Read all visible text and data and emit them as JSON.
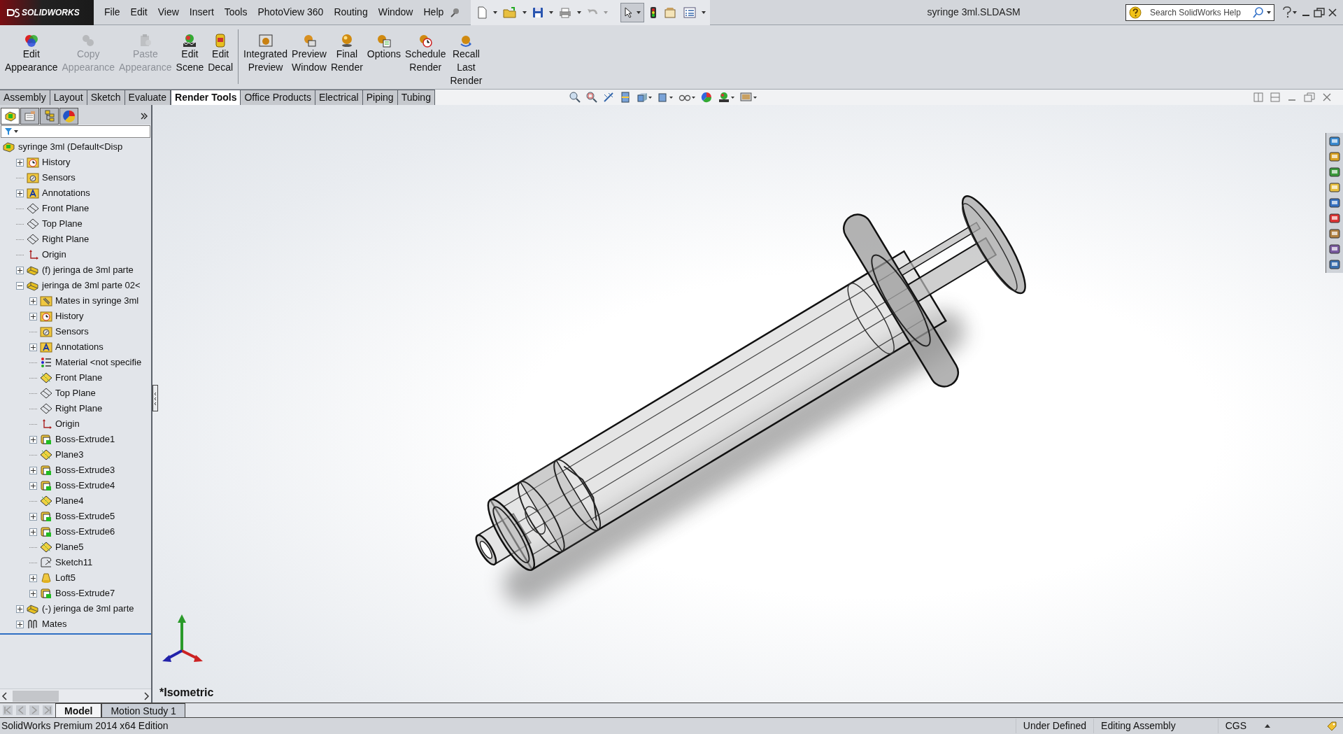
{
  "app": {
    "logo": "SOLIDWORKS",
    "menu": [
      "File",
      "Edit",
      "View",
      "Insert",
      "Tools",
      "PhotoView 360",
      "Routing",
      "Window",
      "Help"
    ],
    "title": "syringe 3ml.SLDASM",
    "search": {
      "placeholder": "Search SolidWorks Help"
    }
  },
  "ribbon": {
    "groups": [
      [
        {
          "label": "Edit\nAppearance",
          "disabled": false
        },
        {
          "label": "Copy\nAppearance",
          "disabled": true
        },
        {
          "label": "Paste\nAppearance",
          "disabled": true
        },
        {
          "label": "Edit\nScene",
          "disabled": false
        },
        {
          "label": "Edit\nDecal",
          "disabled": false
        }
      ],
      [
        {
          "label": "Integrated\nPreview",
          "disabled": false
        },
        {
          "label": "Preview\nWindow",
          "disabled": false
        },
        {
          "label": "Final\nRender",
          "disabled": false
        },
        {
          "label": "Options",
          "disabled": false
        },
        {
          "label": "Schedule\nRender",
          "disabled": false
        },
        {
          "label": "Recall\nLast\nRender",
          "disabled": false
        }
      ]
    ]
  },
  "command_tabs": [
    {
      "label": "Assembly",
      "selected": false
    },
    {
      "label": "Layout",
      "selected": false
    },
    {
      "label": "Sketch",
      "selected": false
    },
    {
      "label": "Evaluate",
      "selected": false
    },
    {
      "label": "Render Tools",
      "selected": true
    },
    {
      "label": "Office Products",
      "selected": false
    },
    {
      "label": "Electrical",
      "selected": false
    },
    {
      "label": "Piping",
      "selected": false
    },
    {
      "label": "Tubing",
      "selected": false
    }
  ],
  "feature_manager": {
    "panel_tabs": [
      {
        "kind": "tree",
        "selected": true
      },
      {
        "kind": "property",
        "selected": false
      },
      {
        "kind": "config",
        "selected": false
      },
      {
        "kind": "display",
        "selected": false
      }
    ],
    "tree": [
      {
        "label": "syringe 3ml (Default<Disp",
        "kind": "assembly",
        "children": [
          {
            "label": "History",
            "kind": "history",
            "expanded": false
          },
          {
            "label": "Sensors",
            "kind": "sensors"
          },
          {
            "label": "Annotations",
            "kind": "annotations",
            "expanded": false
          },
          {
            "label": "Front Plane",
            "kind": "plane"
          },
          {
            "label": "Top Plane",
            "kind": "plane"
          },
          {
            "label": "Right Plane",
            "kind": "plane"
          },
          {
            "label": "Origin",
            "kind": "origin"
          },
          {
            "label": "(f) jeringa de 3ml parte",
            "kind": "part",
            "expanded": false
          },
          {
            "label": "jeringa de 3ml parte 02<",
            "kind": "part",
            "expanded": true,
            "children": [
              {
                "label": "Mates in syringe 3ml",
                "kind": "mates_folder",
                "expanded": false
              },
              {
                "label": "History",
                "kind": "history",
                "expanded": false
              },
              {
                "label": "Sensors",
                "kind": "sensors"
              },
              {
                "label": "Annotations",
                "kind": "annotations",
                "expanded": false
              },
              {
                "label": "Material <not specifie",
                "kind": "material"
              },
              {
                "label": "Front Plane",
                "kind": "ref_plane"
              },
              {
                "label": "Top Plane",
                "kind": "plane"
              },
              {
                "label": "Right Plane",
                "kind": "plane"
              },
              {
                "label": "Origin",
                "kind": "origin"
              },
              {
                "label": "Boss-Extrude1",
                "kind": "feature",
                "expanded": false
              },
              {
                "label": "Plane3",
                "kind": "ref_plane"
              },
              {
                "label": "Boss-Extrude3",
                "kind": "feature",
                "expanded": false
              },
              {
                "label": "Boss-Extrude4",
                "kind": "feature",
                "expanded": false
              },
              {
                "label": "Plane4",
                "kind": "ref_plane"
              },
              {
                "label": "Boss-Extrude5",
                "kind": "feature",
                "expanded": false
              },
              {
                "label": "Boss-Extrude6",
                "kind": "feature",
                "expanded": false
              },
              {
                "label": "Plane5",
                "kind": "ref_plane"
              },
              {
                "label": "Sketch11",
                "kind": "sketch"
              },
              {
                "label": "Loft5",
                "kind": "loft",
                "expanded": false
              },
              {
                "label": "Boss-Extrude7",
                "kind": "feature",
                "expanded": false
              }
            ]
          },
          {
            "label": "(-) jeringa de 3ml parte",
            "kind": "part",
            "expanded": false
          },
          {
            "label": "Mates",
            "kind": "mates",
            "expanded": false
          }
        ]
      }
    ]
  },
  "viewport": {
    "view_label": "*Isometric"
  },
  "bottom_tabs": [
    {
      "label": "Model",
      "selected": true
    },
    {
      "label": "Motion Study 1",
      "selected": false
    }
  ],
  "status_bar": {
    "product": "SolidWorks Premium 2014 x64 Edition",
    "fields": [
      "Under Defined",
      "Editing Assembly",
      "CGS"
    ]
  }
}
